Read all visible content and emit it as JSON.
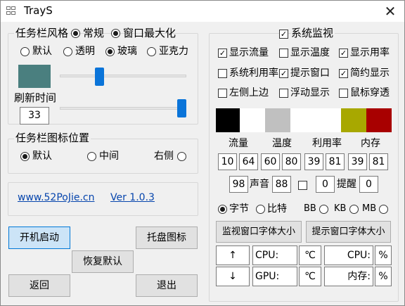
{
  "window": {
    "title": "TrayS",
    "close": "✕"
  },
  "taskbar_style": {
    "heading": "任务栏风格",
    "mode_options": [
      {
        "label": "常规",
        "selected": false
      },
      {
        "label": "窗口最大化",
        "selected": true
      }
    ],
    "effect_options": [
      {
        "label": "默认",
        "selected": false
      },
      {
        "label": "透明",
        "selected": false
      },
      {
        "label": "玻璃",
        "selected": true
      },
      {
        "label": "亚克力",
        "selected": false
      }
    ],
    "preview_color": "#4a7f7f",
    "opacity_level": 0.3,
    "refresh_label": "刷新时间",
    "refresh_value": "33",
    "refresh_level": 1.0
  },
  "icon_position": {
    "heading": "任务栏图标位置",
    "options": [
      {
        "label": "默认",
        "selected": true
      },
      {
        "label": "中间",
        "selected": false
      },
      {
        "label": "右侧",
        "selected": false
      }
    ]
  },
  "about": {
    "site": "www.52PoJie.cn",
    "version": "Ver 1.0.3"
  },
  "buttons": {
    "autostart": "开机启动",
    "tray_icon": "托盘图标",
    "restore": "恢复默认",
    "back": "返回",
    "exit": "退出"
  },
  "monitor": {
    "enable_label": "系统监视",
    "enabled": true,
    "options": [
      {
        "label": "显示流量",
        "checked": true
      },
      {
        "label": "显示温度",
        "checked": false
      },
      {
        "label": "显示用率",
        "checked": true
      },
      {
        "label": "系统利用率",
        "checked": false
      },
      {
        "label": "提示窗口",
        "checked": true
      },
      {
        "label": "简约显示",
        "checked": true
      },
      {
        "label": "左侧上边",
        "checked": false
      },
      {
        "label": "浮动显示",
        "checked": false
      },
      {
        "label": "鼠标穿透",
        "checked": false
      }
    ],
    "colors": [
      "#000000",
      "#ffffff",
      "#c0c0c0",
      "#ffffff",
      "#ffffff",
      "#a8a800",
      "#a80000"
    ],
    "headers": {
      "traffic": "流量",
      "temp": "温度",
      "usage": "利用率",
      "memory": "内存"
    },
    "thresholds": [
      "10",
      "64",
      "60",
      "80",
      "39",
      "81",
      "39",
      "81"
    ],
    "alert_value": "98",
    "sound_label": "声音",
    "sound_value": "88",
    "sound_checked": false,
    "remind_value": "0",
    "remind_label": "提醒",
    "remind_count": "0",
    "units": [
      {
        "label": "字节",
        "selected": true
      },
      {
        "label": "比特",
        "selected": false
      },
      {
        "label": "BB",
        "selected": false
      },
      {
        "label": "KB",
        "selected": false
      },
      {
        "label": "MB",
        "selected": true
      }
    ],
    "font_buttons": {
      "monitor": "监视窗口字体大小",
      "tip": "提示窗口字体大小"
    },
    "up_arrow": "↑",
    "down_arrow": "↓",
    "fields": {
      "cpu_label": "CPU:",
      "temp_unit": "℃",
      "cpu_label2": "CPU:",
      "percent": "%",
      "gpu_label": "GPU:",
      "temp_unit2": "℃",
      "mem_label": "内存:",
      "percent2": "%"
    }
  }
}
